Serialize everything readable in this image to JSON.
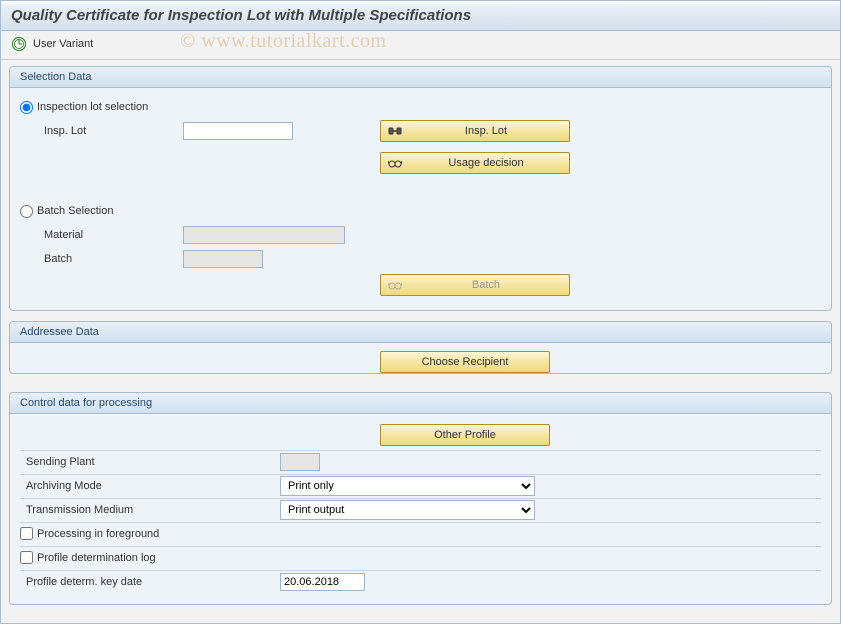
{
  "header": {
    "title": "Quality Certificate for Inspection Lot with Multiple Specifications"
  },
  "toolbar": {
    "user_variant": "User Variant"
  },
  "watermark": "© www.tutorialkart.com",
  "groups": {
    "selection": {
      "title": "Selection Data",
      "insp_radio": "Inspection lot selection",
      "insp_lot_label": "Insp. Lot",
      "insp_lot_value": "",
      "insp_lot_button": "Insp. Lot",
      "usage_decision_button": "Usage decision",
      "batch_radio": "Batch Selection",
      "material_label": "Material",
      "material_value": "",
      "batch_label": "Batch",
      "batch_value": "",
      "batch_button": "Batch"
    },
    "addressee": {
      "title": "Addressee Data",
      "choose_recipient_button": "Choose Recipient"
    },
    "control": {
      "title": "Control data for processing",
      "other_profile_button": "Other Profile",
      "sending_plant_label": "Sending Plant",
      "sending_plant_value": "",
      "archiving_mode_label": "Archiving Mode",
      "archiving_mode_value": "Print only",
      "transmission_medium_label": "Transmission Medium",
      "transmission_medium_value": "Print output",
      "processing_fg_label": "Processing in foreground",
      "profile_log_label": "Profile determination log",
      "profile_date_label": "Profile determ. key date",
      "profile_date_value": "20.06.2018"
    }
  }
}
